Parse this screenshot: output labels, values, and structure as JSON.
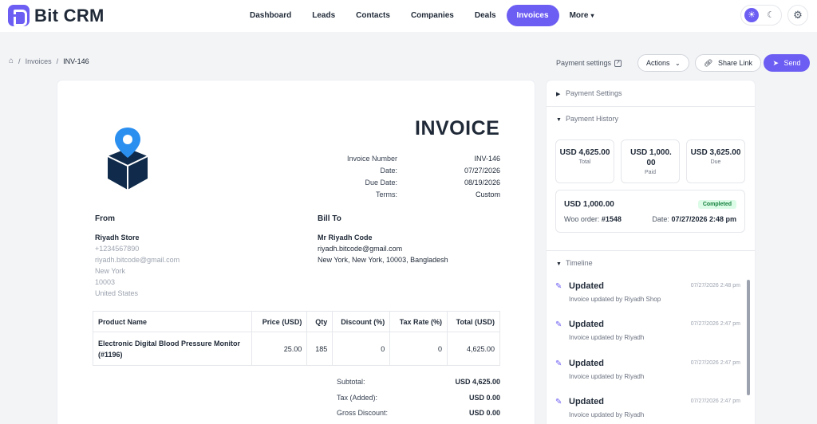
{
  "app": {
    "name": "Bit CRM"
  },
  "nav": {
    "items": [
      {
        "label": "Dashboard"
      },
      {
        "label": "Leads"
      },
      {
        "label": "Contacts"
      },
      {
        "label": "Companies"
      },
      {
        "label": "Deals"
      },
      {
        "label": "Invoices"
      },
      {
        "label": "More"
      }
    ],
    "active": "Invoices"
  },
  "breadcrumb": {
    "section": "Invoices",
    "current": "INV-146"
  },
  "actions": {
    "payment_settings": "Payment settings",
    "actions_label": "Actions",
    "share_link": "Share Link",
    "send": "Send"
  },
  "invoice": {
    "title": "INVOICE",
    "meta_labels": {
      "number": "Invoice Number",
      "date": "Date:",
      "due": "Due Date:",
      "terms": "Terms:"
    },
    "meta_values": {
      "number": "INV-146",
      "date": "07/27/2026",
      "due": "08/19/2026",
      "terms": "Custom"
    },
    "from": {
      "heading": "From",
      "name": "Riyadh Store",
      "phone": "+1234567890",
      "email": "riyadh.bitcode@gmail.com",
      "city": "New York",
      "zip": "10003",
      "country": "United States"
    },
    "bill_to": {
      "heading": "Bill To",
      "name": "Mr Riyadh Code",
      "email": "riyadh.bitcode@gmail.com",
      "address": "New York, New York, 10003, Bangladesh"
    },
    "table": {
      "headers": [
        "Product Name",
        "Price (USD)",
        "Qty",
        "Discount (%)",
        "Tax Rate (%)",
        "Total (USD)"
      ],
      "rows": [
        {
          "name_line1": "Electronic Digital Blood Pressure Monitor",
          "name_line2": "(#1196)",
          "price": "25.00",
          "qty": "185",
          "discount": "0",
          "tax": "0",
          "total": "4,625.00"
        }
      ]
    },
    "totals": {
      "subtotal_label": "Subtotal:",
      "subtotal": "USD 4,625.00",
      "tax_label": "Tax (Added):",
      "tax": "USD 0.00",
      "discount_label": "Gross Discount:",
      "discount": "USD 0.00"
    }
  },
  "panel": {
    "payment_settings": "Payment Settings",
    "payment_history": "Payment History",
    "stats": [
      {
        "value": "USD 4,625.00",
        "label": "Total"
      },
      {
        "value": "USD 1,000.00",
        "label": "Paid"
      },
      {
        "value": "USD 3,625.00",
        "label": "Due"
      }
    ],
    "payment": {
      "amount": "USD 1,000.00",
      "status": "Completed",
      "order_label": "Woo order:",
      "order_no": "#1548",
      "date_label": "Date:",
      "date": "07/27/2026 2:48 pm"
    },
    "timeline_title": "Timeline",
    "timeline": [
      {
        "title": "Updated",
        "desc": "Invoice updated by Riyadh Shop",
        "time": "07/27/2026 2:48 pm"
      },
      {
        "title": "Updated",
        "desc": "Invoice updated by Riyadh",
        "time": "07/27/2026 2:47 pm"
      },
      {
        "title": "Updated",
        "desc": "Invoice updated by Riyadh",
        "time": "07/27/2026 2:47 pm"
      },
      {
        "title": "Updated",
        "desc": "Invoice updated by Riyadh",
        "time": "07/27/2026 2:47 pm"
      }
    ]
  },
  "colors": {
    "accent": "#6d5ef3",
    "success": "#15803d",
    "icon_blue": "#2b8ff0",
    "icon_navy": "#0f2a4a"
  },
  "icons": [
    "home-icon",
    "external-link-icon",
    "chevron-down-icon",
    "link-icon",
    "send-icon",
    "sun-icon",
    "moon-icon",
    "gear-icon",
    "caret-right-icon",
    "caret-down-icon",
    "edit-icon"
  ]
}
